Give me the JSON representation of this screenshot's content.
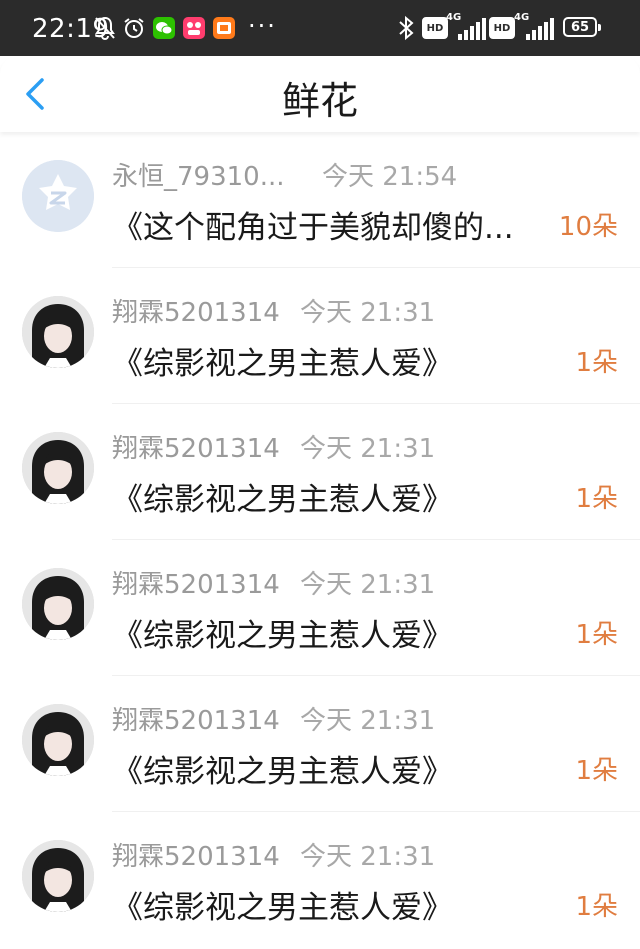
{
  "status_bar": {
    "time": "22:19",
    "dots": "···",
    "hd1": "HD",
    "net1": "4G",
    "hd2": "HD",
    "net2": "4G",
    "battery": "65"
  },
  "header": {
    "title": "鲜花"
  },
  "colors": {
    "accent": "#2b9ef3",
    "count": "#e07d40"
  },
  "items": [
    {
      "name": "永恒_79310...",
      "time": "今天 21:54",
      "book": "《这个配角过于美貌却傻的...",
      "count": "10朵",
      "avatar": "default"
    },
    {
      "name": "翔霖5201314",
      "time": "今天 21:31",
      "book": "《综影视之男主惹人爱》",
      "count": "1朵",
      "avatar": "photo"
    },
    {
      "name": "翔霖5201314",
      "time": "今天 21:31",
      "book": "《综影视之男主惹人爱》",
      "count": "1朵",
      "avatar": "photo"
    },
    {
      "name": "翔霖5201314",
      "time": "今天 21:31",
      "book": "《综影视之男主惹人爱》",
      "count": "1朵",
      "avatar": "photo"
    },
    {
      "name": "翔霖5201314",
      "time": "今天 21:31",
      "book": "《综影视之男主惹人爱》",
      "count": "1朵",
      "avatar": "photo"
    },
    {
      "name": "翔霖5201314",
      "time": "今天 21:31",
      "book": "《综影视之男主惹人爱》",
      "count": "1朵",
      "avatar": "photo"
    }
  ]
}
